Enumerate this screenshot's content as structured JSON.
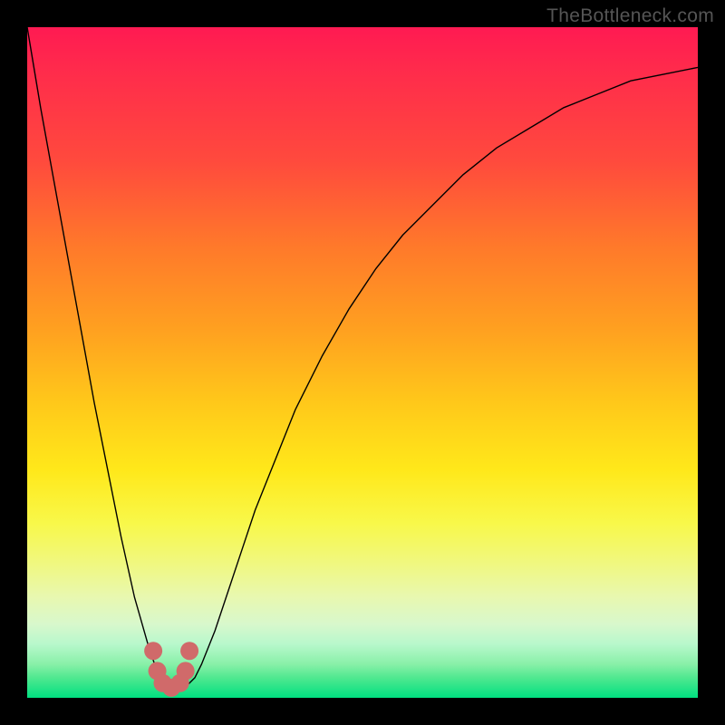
{
  "watermark": "TheBottleneck.com",
  "chart_data": {
    "type": "line",
    "title": "",
    "xlabel": "",
    "ylabel": "",
    "xlim": [
      0,
      100
    ],
    "ylim": [
      0,
      100
    ],
    "curve": {
      "samples_x": [
        0,
        2,
        4,
        6,
        8,
        10,
        12,
        14,
        16,
        18,
        19,
        20,
        21,
        22,
        23,
        24,
        25,
        26,
        28,
        30,
        32,
        34,
        36,
        38,
        40,
        44,
        48,
        52,
        56,
        60,
        65,
        70,
        75,
        80,
        85,
        90,
        95,
        100
      ],
      "samples_y": [
        100,
        88,
        77,
        66,
        55,
        44,
        34,
        24,
        15,
        8,
        5,
        3,
        2,
        1.5,
        1.5,
        2,
        3,
        5,
        10,
        16,
        22,
        28,
        33,
        38,
        43,
        51,
        58,
        64,
        69,
        73,
        78,
        82,
        85,
        88,
        90,
        92,
        93,
        94
      ],
      "style": {
        "stroke": "#000000",
        "width": 1.4
      }
    },
    "markers": {
      "points_x": [
        18.8,
        19.4,
        20.2,
        21.5,
        22.8,
        23.6,
        24.2
      ],
      "points_y": [
        7,
        4,
        2.2,
        1.5,
        2.2,
        4,
        7
      ],
      "style": {
        "fill": "#d06a6a",
        "radius": 10
      }
    }
  }
}
